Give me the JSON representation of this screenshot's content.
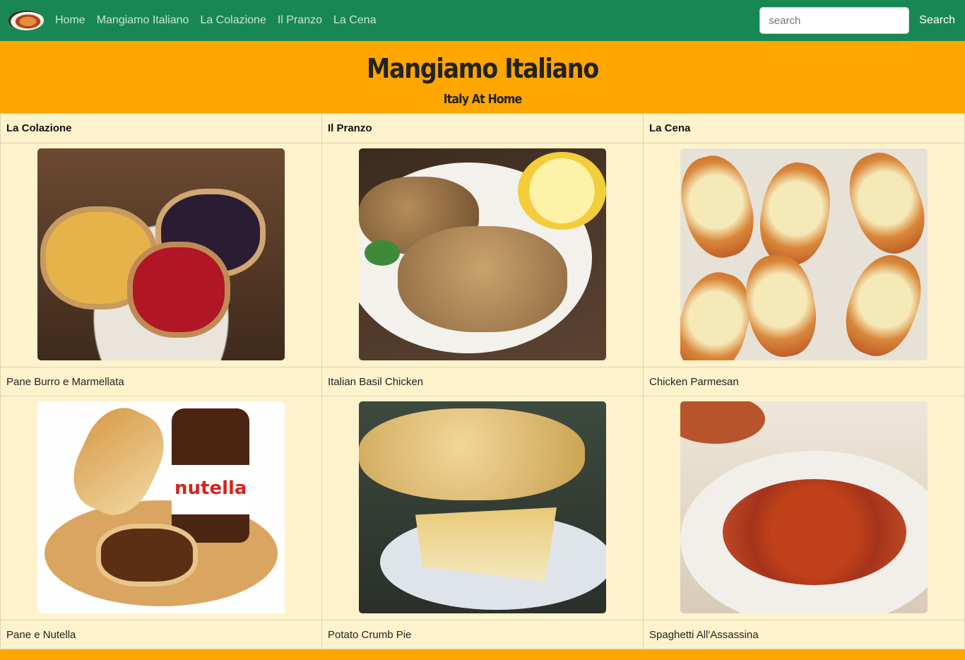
{
  "navbar": {
    "logo_icon": "food-plate-logo-icon",
    "links": [
      "Home",
      "Mangiamo Italiano",
      "La Colazione",
      "Il Pranzo",
      "La Cena"
    ],
    "search": {
      "placeholder": "search",
      "button_label": "Search"
    },
    "colors": {
      "background": "#198754",
      "link": "#c8e6d4"
    }
  },
  "banner": {
    "title": "Mangiamo Italiano",
    "subtitle": "Italy At Home",
    "background": "#ffa600"
  },
  "menu_table": {
    "headers": [
      "La Colazione",
      "Il Pranzo",
      "La Cena"
    ],
    "rows": [
      [
        "Pane Burro e Marmellata",
        "Italian Basil Chicken",
        "Chicken Parmesan"
      ],
      [
        "Pane e Nutella",
        "Potato Crumb Pie",
        "Spaghetti All'Assassina"
      ]
    ],
    "photo_images": [
      [
        "bread-butter-jam-photo",
        "basil-chicken-photo",
        "chicken-parmesan-photo"
      ],
      [
        "bread-nutella-photo",
        "potato-crumb-pie-photo",
        "spaghetti-assassina-photo"
      ]
    ],
    "photo_text": {
      "nutella_label": "nutella"
    },
    "background": "#fff3cd"
  }
}
